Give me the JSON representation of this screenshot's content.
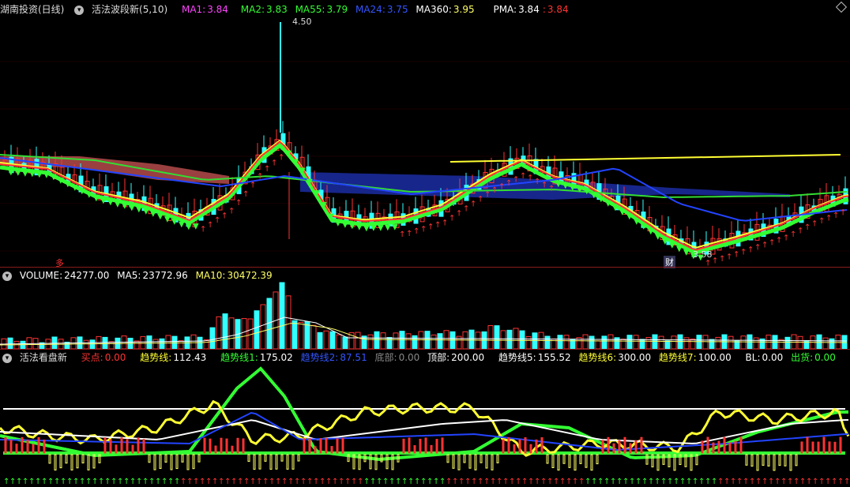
{
  "main_panel": {
    "title": "湖南投资(日线)",
    "indicator_name": "活法波段新",
    "indicator_params": "(5,10)",
    "ma": [
      {
        "label": "MA1:",
        "value": "3.84",
        "color": "#ff44ff"
      },
      {
        "label": "MA2:",
        "value": "3.83",
        "color": "#33ff33"
      },
      {
        "label": "MA55:",
        "value": "3.79",
        "color": "#33ff33"
      },
      {
        "label": "MA24:",
        "value": "3.75",
        "color": "#3355ff"
      },
      {
        "label": "MA360:",
        "value": "3.95",
        "color": "#ffffff"
      }
    ],
    "pma_label": "PMA:",
    "pma_value1": "3.84",
    "pma_value2": "3.84",
    "high_price": "4.50",
    "low_price": "3.58",
    "marker_cai": "财",
    "marker_left": "多"
  },
  "volume_panel": {
    "label": "VOLUME:",
    "value": "24277.00",
    "ma5_label": "MA5:",
    "ma5_value": "23772.96",
    "ma10_label": "MA10:",
    "ma10_value": "30472.39"
  },
  "bottom_panel": {
    "title": "活法看盘新",
    "items": [
      {
        "label": "买点:",
        "value": "0.00",
        "color": "#ff3333"
      },
      {
        "label": "趋势线:",
        "value": "112.43",
        "color": "#ffff33"
      },
      {
        "label": "趋势线1:",
        "value": "175.02",
        "color": "#33ff33"
      },
      {
        "label": "趋势线2:",
        "value": "87.51",
        "color": "#3355ff"
      },
      {
        "label": "底部:",
        "value": "0.00",
        "color": "#888888"
      },
      {
        "label": "顶部:",
        "value": "200.00",
        "color": "#ffffff"
      },
      {
        "label": "趋势线5:",
        "value": "155.52",
        "color": "#ffffff"
      },
      {
        "label": "趋势线6:",
        "value": "300.00",
        "color": "#ffff33"
      },
      {
        "label": "趋势线7:",
        "value": "100.00",
        "color": "#ffff33"
      },
      {
        "label": "BL:",
        "value": "0.00",
        "color": "#ffffff"
      },
      {
        "label": "出货:",
        "value": "0.00",
        "color": "#33ff33"
      }
    ]
  },
  "colors": {
    "up": "#ff3333",
    "down": "#33ffff",
    "separator": "#8a1a1a"
  }
}
